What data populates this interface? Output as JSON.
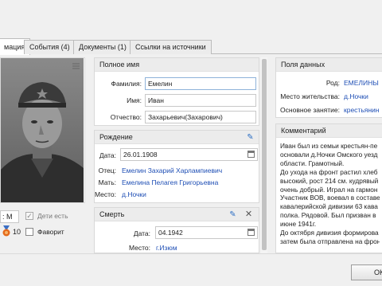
{
  "tabs": [
    {
      "label": "мация"
    },
    {
      "label": "События (4)"
    },
    {
      "label": "Документы (1)"
    },
    {
      "label": "Ссылки на источники"
    }
  ],
  "left": {
    "gender_value": ": М",
    "children_label": "Дети есть",
    "children_checked": true,
    "medal_count": "10",
    "favorite_label": "Фаворит",
    "favorite_checked": false
  },
  "full_name": {
    "header": "Полное имя",
    "surname_label": "Фамилия:",
    "surname_value": "Емелин",
    "name_label": "Имя:",
    "name_value": "Иван",
    "patronymic_label": "Отчество:",
    "patronymic_value": "Захарьевич(Захарович)"
  },
  "birth": {
    "header": "Рождение",
    "date_label": "Дата:",
    "date_value": "26.01.1908",
    "father_label": "Отец:",
    "father_value": "Емелин Захарий Харлампиевич",
    "mother_label": "Мать:",
    "mother_value": "Емелина Пелагея Григорьевна",
    "place_label": "Место:",
    "place_value": "д.Ночки"
  },
  "death": {
    "header": "Смерть",
    "date_label": "Дата:",
    "date_value": "04.1942",
    "place_label": "Место:",
    "place_value": "г.Изюм"
  },
  "data_fields": {
    "header": "Поля данных",
    "clan_label": "Род:",
    "clan_value": "ЕМЕЛИНЫ",
    "residence_label": "Место жительства:",
    "residence_value": "д.Ночки",
    "occupation_label": "Основное занятие:",
    "occupation_value": "крестьянин"
  },
  "comment": {
    "header": "Комментарий",
    "lines": [
      "Иван был из семьи крестьян-пе",
      "основали д.Ночки Омского уезд",
      "области. Грамотный.",
      "До ухода на фронт растил хлеб",
      "высокий, рост 214 см. кудрявый",
      "очень добрый. Играл на гармон",
      "Участник ВОВ, воевал в составе",
      "кавалерийской дивизии 63 кава",
      "полка. Рядовой. Был призван в",
      "июне 1941г.",
      "До октября дивизия формирова",
      "затем была отправлена на фрон"
    ]
  },
  "ok_button": {
    "label": "OK"
  },
  "colors": {
    "link": "#1f4fb5",
    "accent_edit": "#2d6fc4"
  }
}
